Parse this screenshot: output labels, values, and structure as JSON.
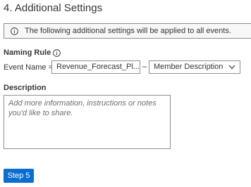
{
  "section": {
    "title": "4. Additional Settings"
  },
  "info_banner": {
    "icon": "info-icon",
    "text": "The following additional settings will be applied to all events."
  },
  "naming_rule": {
    "label": "Naming Rule",
    "icon": "info-icon",
    "event_name_label": "Event Name =",
    "event_name_value": "Revenue_Forecast_Pl...",
    "separator": "–",
    "suffix_select": "Member Description"
  },
  "description": {
    "label": "Description",
    "placeholder": "Add more information, instructions or notes you'd like to share."
  },
  "step_button": {
    "label": "Step 5"
  }
}
